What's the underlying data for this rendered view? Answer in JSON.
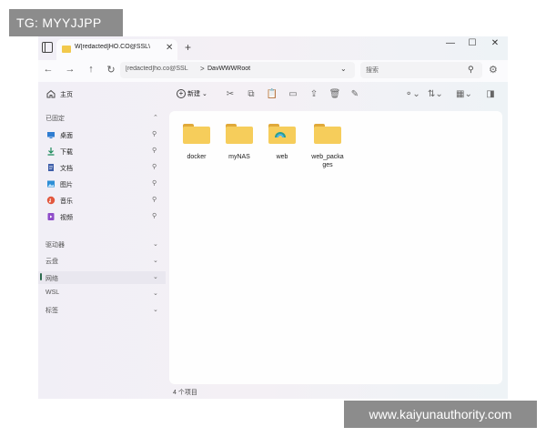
{
  "overlays": {
    "tag": "TG: MYYJJPP",
    "watermark": "www.kaiyunauthority.com"
  },
  "titlebar": {
    "tab_label": "W[redacted]HO.CO@SSL\\",
    "close": "✕",
    "new_tab": "+",
    "minimize": "—",
    "maximize": "☐",
    "window_close": "✕"
  },
  "navbar": {
    "back": "←",
    "forward": "→",
    "up": "↑",
    "refresh": "↻",
    "host": "[redacted]ho.co@SSL",
    "separator": ">",
    "path": "DavWWWRoot",
    "dropdown": "⌄",
    "search_placeholder": "搜索",
    "search_icon": "⚲",
    "settings_icon": "⚙"
  },
  "sidebar": {
    "home": {
      "label": "主页",
      "icon": "home-icon"
    },
    "pinned_header": "已固定",
    "pinned": [
      {
        "label": "桌面",
        "icon": "desktop-icon",
        "color": "#2f7dd1"
      },
      {
        "label": "下载",
        "icon": "download-icon",
        "color": "#1b8a5a"
      },
      {
        "label": "文档",
        "icon": "document-icon",
        "color": "#3e5ea9"
      },
      {
        "label": "图片",
        "icon": "pictures-icon",
        "color": "#2d8fd6"
      },
      {
        "label": "音乐",
        "icon": "music-icon",
        "color": "#e2583e"
      },
      {
        "label": "视频",
        "icon": "video-icon",
        "color": "#8e4bc9"
      }
    ],
    "sections": [
      {
        "label": "驱动器"
      },
      {
        "label": "云盘"
      },
      {
        "label": "网络"
      },
      {
        "label": "WSL"
      },
      {
        "label": "标签"
      }
    ],
    "pin_glyph": "⚲",
    "chev_glyph": "⌄",
    "chev_up_glyph": "⌃"
  },
  "toolbar": {
    "new_label": "新建",
    "new_glyph": "+"
  },
  "files": [
    {
      "name": "docker",
      "icon": "folder-icon"
    },
    {
      "name": "myNAS",
      "icon": "folder-icon"
    },
    {
      "name": "web",
      "icon": "web-folder-icon"
    },
    {
      "name": "web_packages",
      "icon": "folder-icon"
    }
  ],
  "status": {
    "count": "4 个项目"
  },
  "colors": {
    "folder": "#f6cd5b",
    "folder_tab": "#e0a93a",
    "selection_indicator": "#2d6b4e"
  }
}
